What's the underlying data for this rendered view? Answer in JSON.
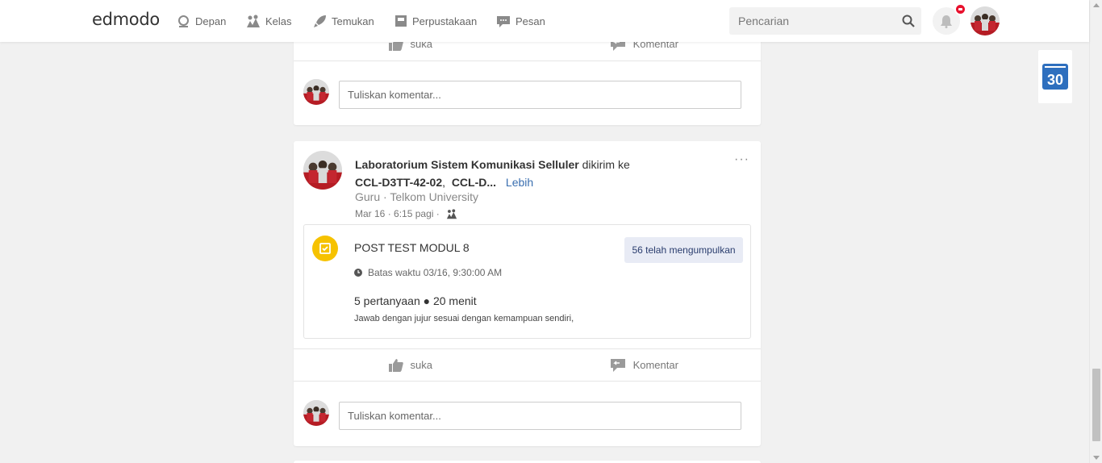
{
  "navbar": {
    "logo": "edmodo",
    "items": [
      {
        "label": "Depan",
        "icon": "home-icon"
      },
      {
        "label": "Kelas",
        "icon": "classes-icon"
      },
      {
        "label": "Temukan",
        "icon": "rocket-icon"
      },
      {
        "label": "Perpustakaan",
        "icon": "library-icon"
      },
      {
        "label": "Pesan",
        "icon": "message-icon"
      }
    ],
    "search_placeholder": "Pencarian",
    "notification_badge_color": "#e8112d"
  },
  "feed": {
    "card1": {
      "like_label": "suka",
      "comment_label": "Komentar",
      "comment_placeholder": "Tuliskan komentar..."
    },
    "post": {
      "author": "Laboratorium Sistem Komunikasi Selluler",
      "sent_to_text": "dikirim ke",
      "group1": "CCL-D3TT-42-02",
      "group2": "CCL-D...",
      "more_link": "Lebih",
      "role": "Guru",
      "separator": "·",
      "school": "Telkom University",
      "date": "Mar 16",
      "time": "6:15 pagi",
      "menu": "···",
      "quiz": {
        "title": "POST TEST MODUL 8",
        "submitted": "56 telah mengumpulkan",
        "deadline": "Batas waktu 03/16, 9:30:00 AM",
        "meta": "5 pertanyaan ● 20 menit",
        "description": "Jawab dengan jujur sesuai dengan kemampuan sendiri,"
      },
      "like_label": "suka",
      "comment_label": "Komentar",
      "comment_placeholder": "Tuliskan komentar..."
    }
  },
  "widget": {
    "calendar_day": "30",
    "accent": "#2e6fbe"
  }
}
